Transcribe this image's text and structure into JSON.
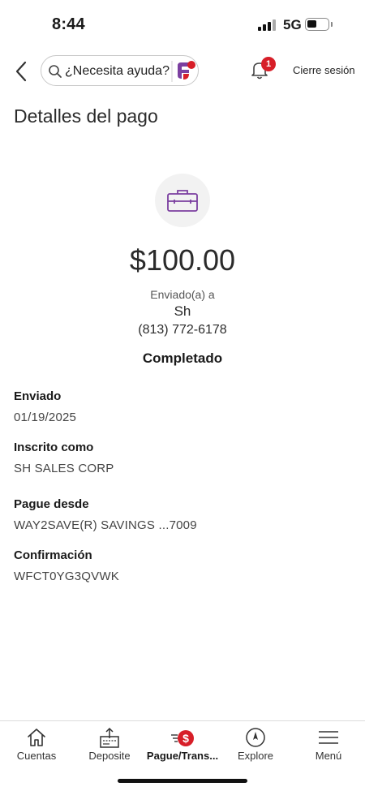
{
  "status_bar": {
    "time": "8:44",
    "network": "5G"
  },
  "header": {
    "search_placeholder": "¿Necesita ayuda?",
    "notification_count": "1",
    "logout_label": "Cierre sesión"
  },
  "page": {
    "title": "Detalles del pago",
    "amount": "$100.00",
    "sent_to_label": "Enviado(a) a",
    "recipient_name": "Sh",
    "recipient_phone": "(813) 772-6178",
    "status": "Completado"
  },
  "details": [
    {
      "label": "Enviado",
      "value": "01/19/2025"
    },
    {
      "label": "Inscrito como",
      "value": "SH SALES CORP"
    },
    {
      "label": "Pague desde",
      "value": "WAY2SAVE(R) SAVINGS ...7009"
    },
    {
      "label": "Confirmación",
      "value": "WFCT0YG3QVWK"
    }
  ],
  "bottom_nav": [
    {
      "label": "Cuentas",
      "icon": "home-icon"
    },
    {
      "label": "Deposite",
      "icon": "deposit-icon"
    },
    {
      "label": "Pague/Trans...",
      "icon": "pay-transfer-icon",
      "active": true
    },
    {
      "label": "Explore",
      "icon": "compass-icon"
    },
    {
      "label": "Menú",
      "icon": "hamburger-menu-icon"
    }
  ],
  "colors": {
    "brand_red": "#d71e28",
    "brand_purple": "#7b3fa0"
  }
}
